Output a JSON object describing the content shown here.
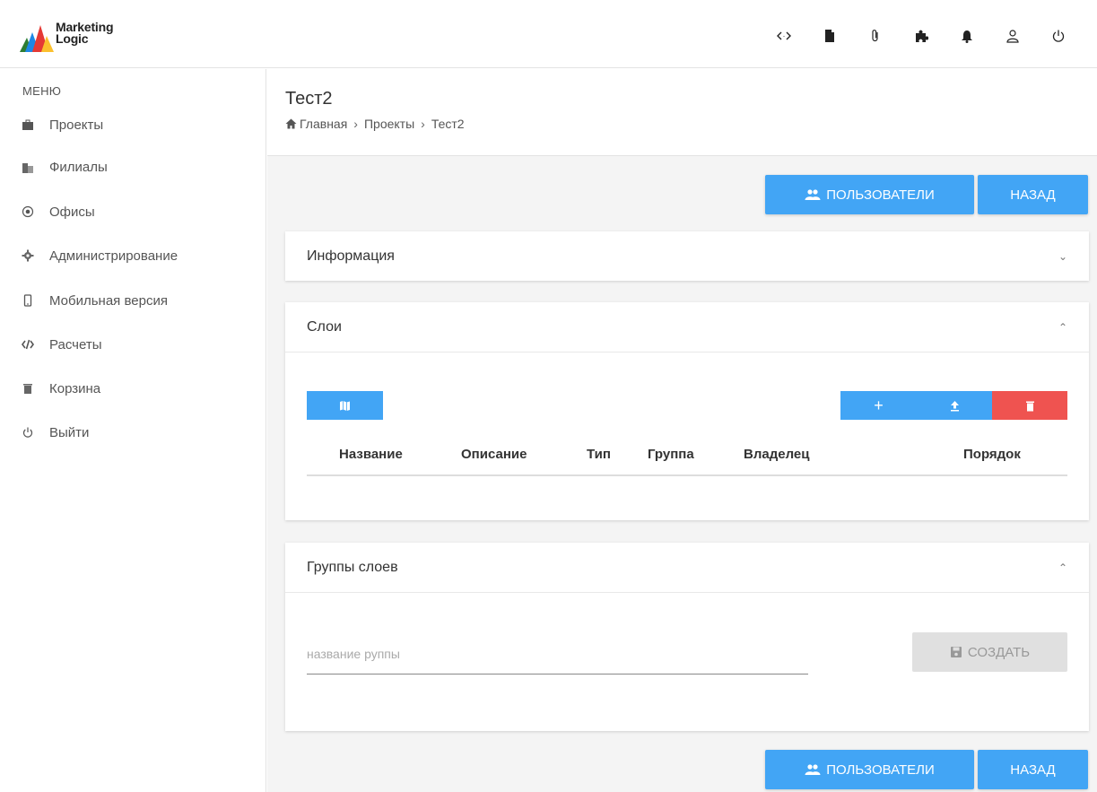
{
  "app": {
    "logo_line1": "Marketing",
    "logo_line2": "Logic"
  },
  "topbar": {
    "icons": [
      "code-icon",
      "file-icon",
      "paperclip-icon",
      "puzzle-icon",
      "bell-icon",
      "user-icon",
      "power-icon"
    ]
  },
  "sidebar": {
    "title": "МЕНЮ",
    "items": [
      {
        "label": "Проекты",
        "icon": "briefcase-icon"
      },
      {
        "label": "Филиалы",
        "icon": "building-icon"
      },
      {
        "label": "Офисы",
        "icon": "crosshair-icon"
      },
      {
        "label": "Администрирование",
        "icon": "gear-icon"
      },
      {
        "label": "Мобильная версия",
        "icon": "mobile-icon"
      },
      {
        "label": "Расчеты",
        "icon": "calc-icon"
      },
      {
        "label": "Корзина",
        "icon": "trash-icon"
      },
      {
        "label": "Выйти",
        "icon": "power-icon"
      }
    ]
  },
  "page": {
    "title": "Тест2",
    "breadcrumb": [
      "Главная",
      "Проекты",
      "Тест2"
    ]
  },
  "actions": {
    "users_label": "ПОЛЬЗОВАТЕЛИ",
    "back_label": "НАЗАД"
  },
  "info_card": {
    "title": "Информация"
  },
  "layers_card": {
    "title": "Слои",
    "columns": [
      "Название",
      "Описание",
      "Тип",
      "Группа",
      "Владелец",
      "Порядок"
    ],
    "add_label": "+"
  },
  "groups_card": {
    "title": "Группы слоев",
    "input_placeholder": "название руппы",
    "create_label": "СОЗДАТЬ"
  },
  "colors": {
    "primary": "#42a5f5",
    "danger": "#ef5350",
    "disabled": "#e0e0e0"
  }
}
